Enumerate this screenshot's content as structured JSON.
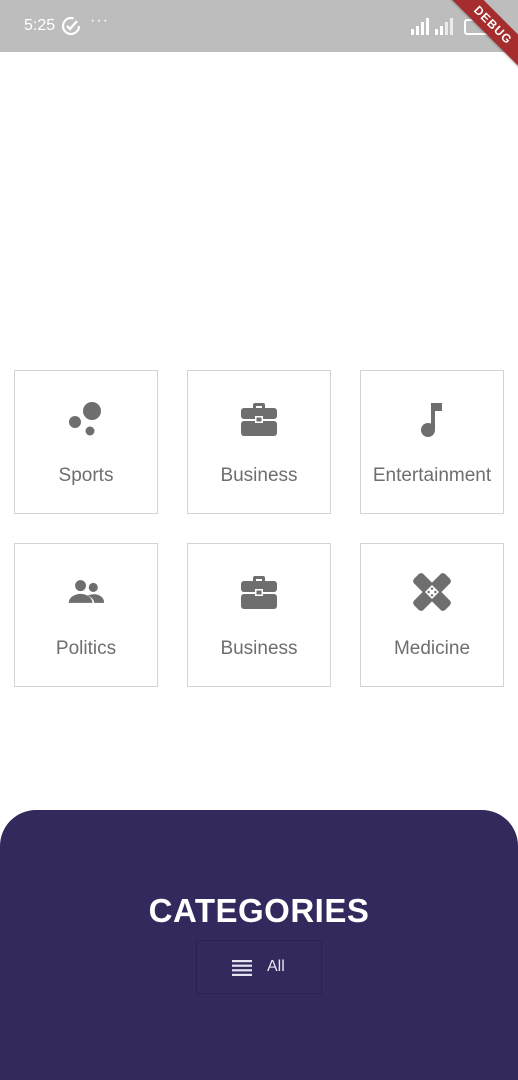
{
  "status_bar": {
    "time": "5:25",
    "dots": "···",
    "icons": [
      "check-circle-icon",
      "signal-icon",
      "signal-icon",
      "battery-icon"
    ]
  },
  "debug_banner": {
    "label": "DEBUG"
  },
  "categories": [
    {
      "label": "Sports",
      "icon": "bubbles-icon"
    },
    {
      "label": "Business",
      "icon": "briefcase-icon"
    },
    {
      "label": "Entertainment",
      "icon": "music-note-icon"
    },
    {
      "label": "Politics",
      "icon": "people-icon"
    },
    {
      "label": "Business",
      "icon": "briefcase-icon"
    },
    {
      "label": "Medicine",
      "icon": "healing-icon"
    }
  ],
  "bottom_panel": {
    "title": "CATEGORIES",
    "all_button": {
      "label": "All",
      "icon": "list-icon"
    }
  },
  "colors": {
    "status_bar": "#bdbdbd",
    "icon_gray": "#6e6e6e",
    "tile_border": "#d4d4d4",
    "panel_background": "#34295d",
    "debug_banner": "#a52d2d"
  }
}
